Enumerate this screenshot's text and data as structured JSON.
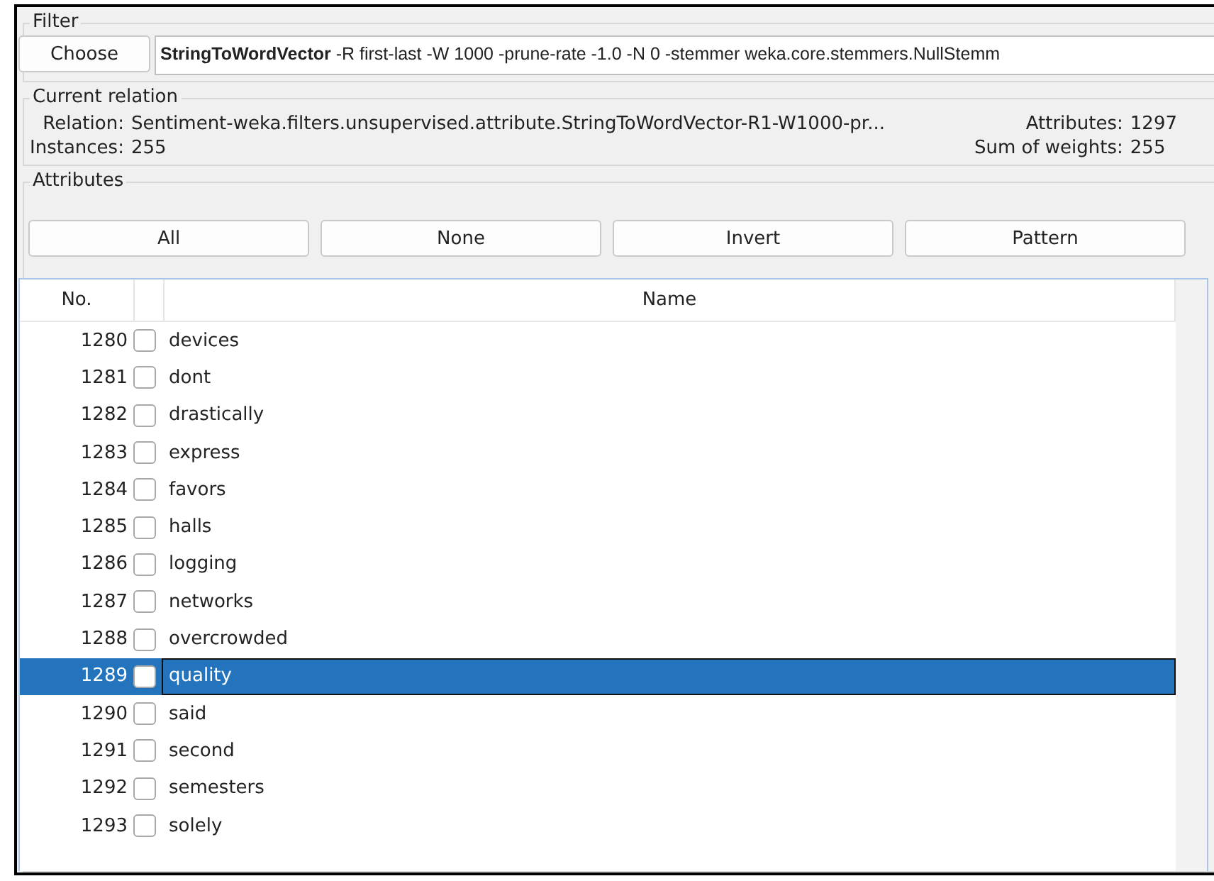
{
  "filter": {
    "title": "Filter",
    "choose_button": "Choose",
    "name": "StringToWordVector",
    "options": "-R first-last -W 1000 -prune-rate -1.0 -N 0 -stemmer weka.core.stemmers.NullStemm"
  },
  "current_relation": {
    "title": "Current relation",
    "relation_label": "Relation:",
    "relation": "Sentiment-weka.filters.unsupervised.attribute.StringToWordVector-R1-W1000-pr...",
    "instances_label": "Instances:",
    "instances": "255",
    "attributes_label": "Attributes:",
    "attributes": "1297",
    "weights_label": "Sum of weights:",
    "weights": "255"
  },
  "attributes": {
    "title": "Attributes",
    "buttons": [
      "All",
      "None",
      "Invert",
      "Pattern"
    ],
    "table": {
      "columns": {
        "no": "No.",
        "name": "Name"
      },
      "rows": [
        {
          "no": "1280",
          "name": "devices",
          "checked": false,
          "selected": false
        },
        {
          "no": "1281",
          "name": "dont",
          "checked": false,
          "selected": false
        },
        {
          "no": "1282",
          "name": "drastically",
          "checked": false,
          "selected": false
        },
        {
          "no": "1283",
          "name": "express",
          "checked": false,
          "selected": false
        },
        {
          "no": "1284",
          "name": "favors",
          "checked": false,
          "selected": false
        },
        {
          "no": "1285",
          "name": "halls",
          "checked": false,
          "selected": false
        },
        {
          "no": "1286",
          "name": "logging",
          "checked": false,
          "selected": false
        },
        {
          "no": "1287",
          "name": "networks",
          "checked": false,
          "selected": false
        },
        {
          "no": "1288",
          "name": "overcrowded",
          "checked": false,
          "selected": false
        },
        {
          "no": "1289",
          "name": "quality",
          "checked": false,
          "selected": true
        },
        {
          "no": "1290",
          "name": "said",
          "checked": false,
          "selected": false
        },
        {
          "no": "1291",
          "name": "second",
          "checked": false,
          "selected": false
        },
        {
          "no": "1292",
          "name": "semesters",
          "checked": false,
          "selected": false
        },
        {
          "no": "1293",
          "name": "solely",
          "checked": false,
          "selected": false
        }
      ]
    }
  }
}
